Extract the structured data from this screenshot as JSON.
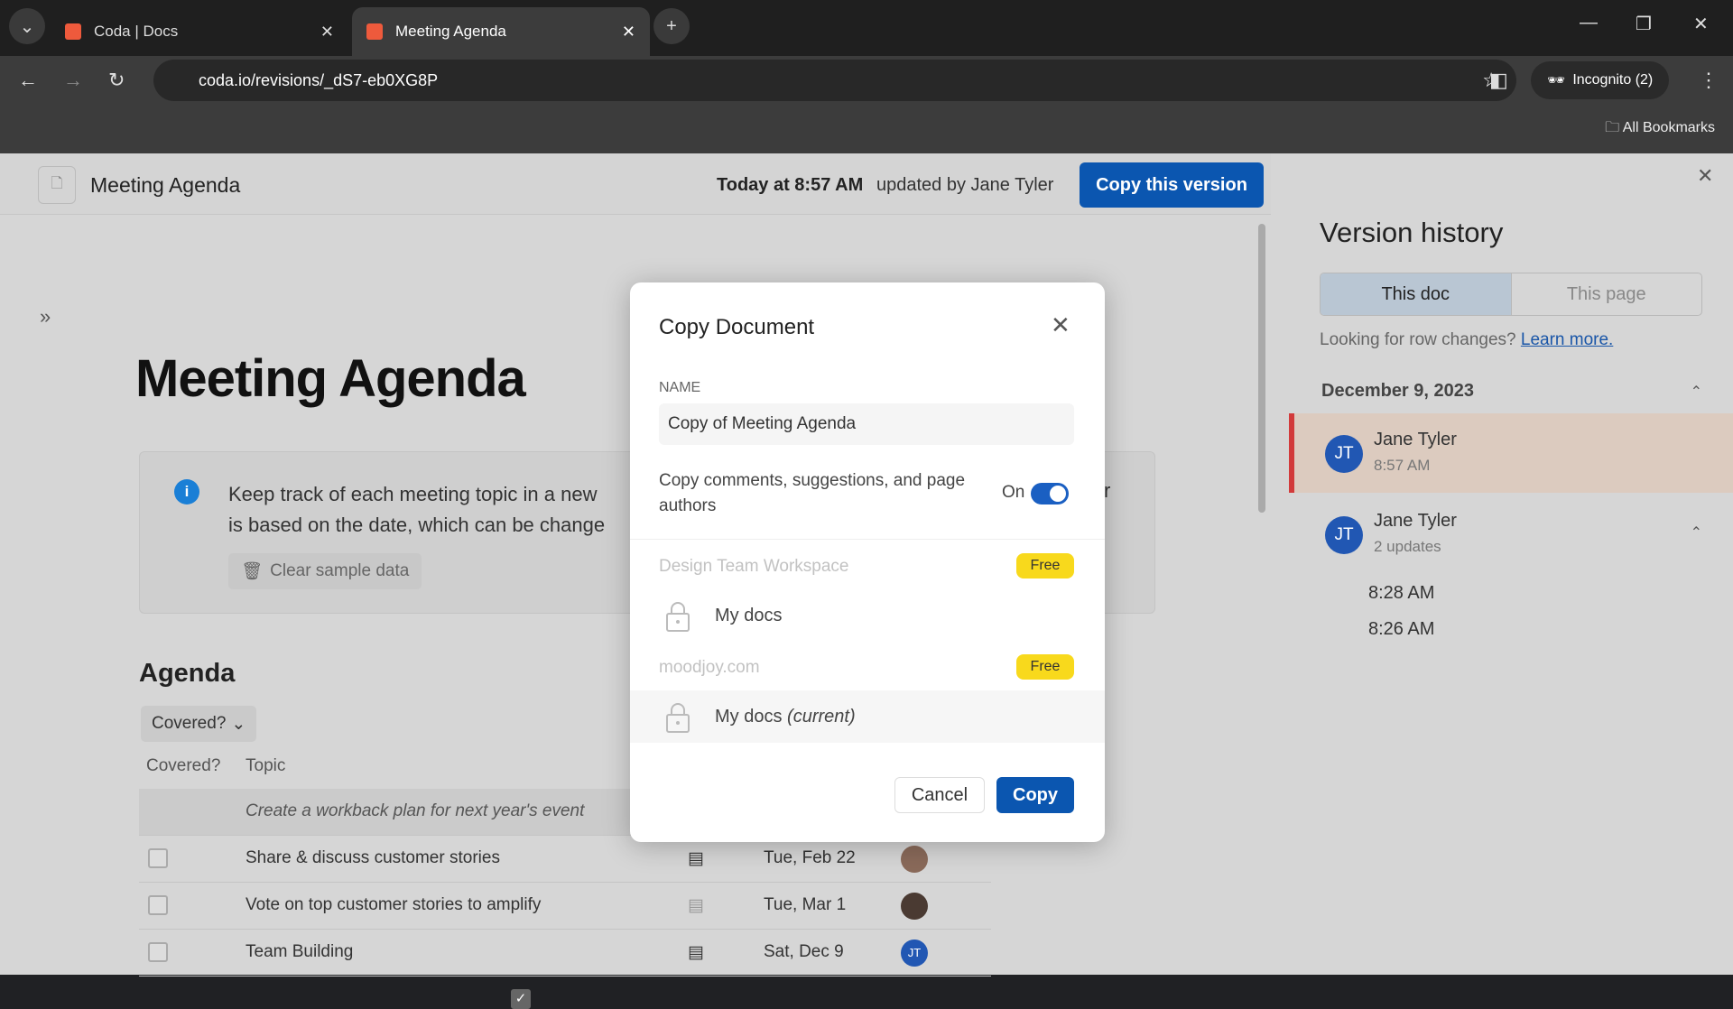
{
  "browser": {
    "tabs": [
      {
        "label": "Coda | Docs"
      },
      {
        "label": "Meeting Agenda"
      }
    ],
    "url": "coda.io/revisions/_dS7-eb0XG8P",
    "incognito": "Incognito (2)",
    "bookmarks": "All Bookmarks"
  },
  "doc_header": {
    "title": "Meeting Agenda",
    "timestamp": "Today at 8:57 AM",
    "updated_by": "updated by Jane Tyler",
    "copy_version": "Copy this version"
  },
  "doc": {
    "title": "Meeting Agenda",
    "callout_line1": "Keep track of each meeting topic in a new",
    "callout_line2": "is based on the date, which can be change",
    "callout_tail": "r",
    "clear_sample": "Clear sample data",
    "section": "Agenda",
    "filter": "Covered?",
    "columns": [
      "Covered?",
      "Topic"
    ],
    "rows": [
      {
        "checked": true,
        "topic": "Create a workback plan for next year's event",
        "date": ""
      },
      {
        "checked": false,
        "topic": "Share & discuss customer stories",
        "date": "Tue, Feb 22"
      },
      {
        "checked": false,
        "topic": "Vote on top customer stories to amplify",
        "date": "Tue, Mar 1"
      },
      {
        "checked": false,
        "topic": "Team Building",
        "date": "Sat, Dec 9",
        "avatar": "JT"
      }
    ]
  },
  "version_history": {
    "title": "Version history",
    "tabs": [
      "This doc",
      "This page"
    ],
    "row_changes": "Looking for row changes?",
    "learn_more": "Learn more.",
    "date": "December 9, 2023",
    "versions": [
      {
        "initials": "JT",
        "name": "Jane Tyler",
        "sub": "8:57 AM"
      },
      {
        "initials": "JT",
        "name": "Jane Tyler",
        "sub": "2 updates"
      }
    ],
    "sub_times": [
      "8:28 AM",
      "8:26 AM"
    ]
  },
  "dialog": {
    "title": "Copy Document",
    "name_label": "NAME",
    "name_value": "Copy of Meeting Agenda",
    "copy_comments": "Copy comments, suggestions, and page authors",
    "toggle_label": "On",
    "toggle_on": true,
    "workspaces": [
      {
        "name": "Design Team Workspace",
        "badge": "Free",
        "dest": "My docs"
      },
      {
        "name": "moodjoy.com",
        "badge": "Free",
        "dest": "My docs",
        "current": "(current)"
      }
    ],
    "cancel": "Cancel",
    "copy": "Copy"
  },
  "colors": {
    "accent": "#0b56b0",
    "badge": "#f8d91c",
    "selected_marker": "#d23a3a"
  }
}
